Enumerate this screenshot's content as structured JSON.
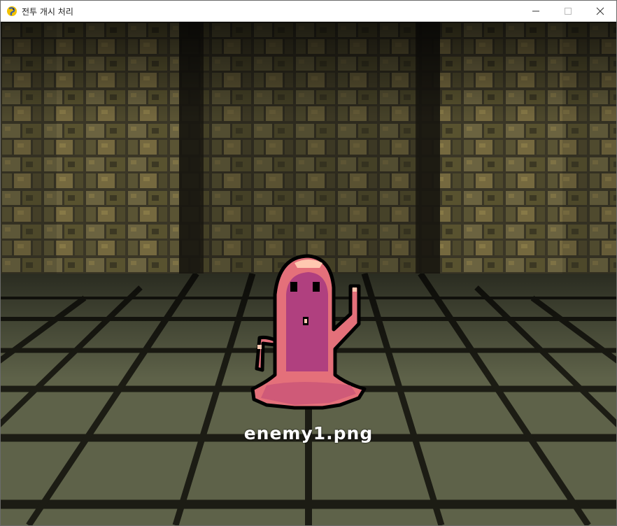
{
  "window": {
    "title": "전투 개시 처리",
    "app_icon": "pygame-snake-icon",
    "controls": [
      "minimize-icon",
      "maximize-icon",
      "close-icon"
    ]
  },
  "game": {
    "enemy_label": "enemy1.png",
    "enemy_sprite": "pink-slime-monster",
    "colors": {
      "label_text": "#ffffff",
      "slime_body": "#e4707a",
      "slime_shadow": "#b0407f",
      "slime_highlight": "#ffc8b0",
      "wall_stone": "#6b6340",
      "floor_tile": "#6f7458",
      "grout": "#1c1c14"
    }
  }
}
